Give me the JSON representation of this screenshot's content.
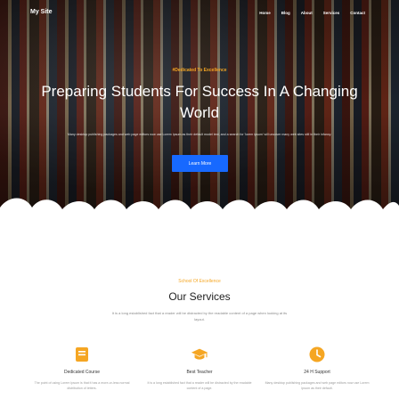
{
  "nav": {
    "logo": "My Site",
    "links": [
      "Home",
      "Blog",
      "About",
      "Services",
      "Contact"
    ]
  },
  "hero": {
    "tagline": "#Dedicated To Excellence",
    "headline": "Preparing Students For Success In A Changing World",
    "subtext": "Many desktop publishing packages and web page editors now use Lorem Ipsum as their default model text, and a search for 'lorem ipsum' will uncover many web sites still in their infancy.",
    "button": "Learn More"
  },
  "services": {
    "eyebrow": "School Of Excellence",
    "title": "Our Services",
    "description": "It is a long established fact that a reader will be distracted by the readable content of a page when looking at its layout.",
    "cards": [
      {
        "icon": "book-icon",
        "title": "Dedicated Course",
        "text": "The point of using Lorem Ipsum is that it has a more-or-less normal distribution of letters."
      },
      {
        "icon": "graduation-cap-icon",
        "title": "Best Teacher",
        "text": "It is a long established fact that a reader will be distracted by the readable content of a page."
      },
      {
        "icon": "clock-icon",
        "title": "24 H Support",
        "text": "Many desktop publishing packages and web page editors now use Lorem Ipsum as their default."
      }
    ]
  },
  "colors": {
    "accent": "#f5a623",
    "button": "#1769ff"
  }
}
